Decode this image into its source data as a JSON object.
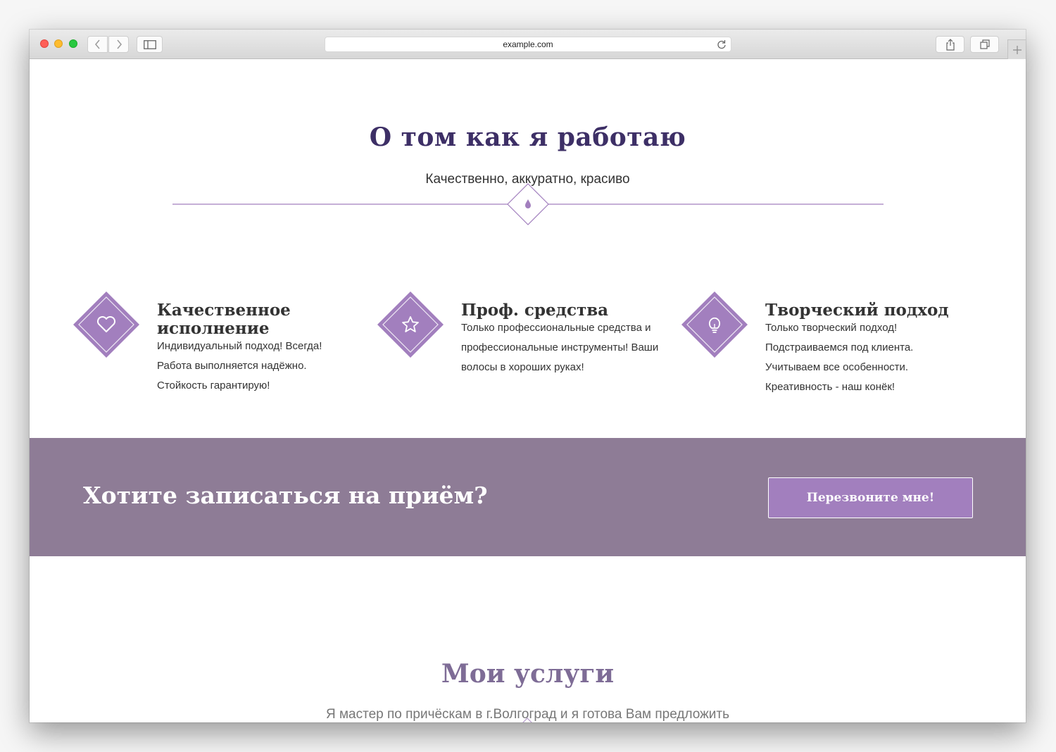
{
  "browser": {
    "url": "example.com"
  },
  "section1": {
    "title": "О том как я работаю",
    "subtitle": "Качественно, аккуратно, красиво",
    "divider_icon": "drop-icon"
  },
  "features": [
    {
      "icon": "heart-icon",
      "title": "Качественное исполнение",
      "text": [
        "Индивидуальный подход! Всегда!",
        "Работа выполняется надёжно.",
        "Стойкость гарантирую!"
      ]
    },
    {
      "icon": "star-icon",
      "title": "Проф. средства",
      "text": [
        "Только профессиональные средства и",
        "профессиональные инструменты! Ваши",
        "волосы в хороших руках!"
      ]
    },
    {
      "icon": "lightbulb-icon",
      "title": "Творческий подход",
      "text": [
        "Только творческий подход!",
        "Подстраиваемся под клиента.",
        "Учитываем все особенности.",
        "Креативность - наш конёк!"
      ]
    }
  ],
  "cta": {
    "title": "Хотите записаться на приём?",
    "button_label": "Перезвоните мне!"
  },
  "section2": {
    "title": "Мои услуги",
    "subtitle": "Я мастер по причёскам в г.Волгоград и я готова Вам предложить"
  },
  "colors": {
    "accent": "#a27fbe",
    "heading_dark": "#3d2f66",
    "cta_bg": "#8e7c96",
    "heading_muted": "#7e6c96"
  }
}
